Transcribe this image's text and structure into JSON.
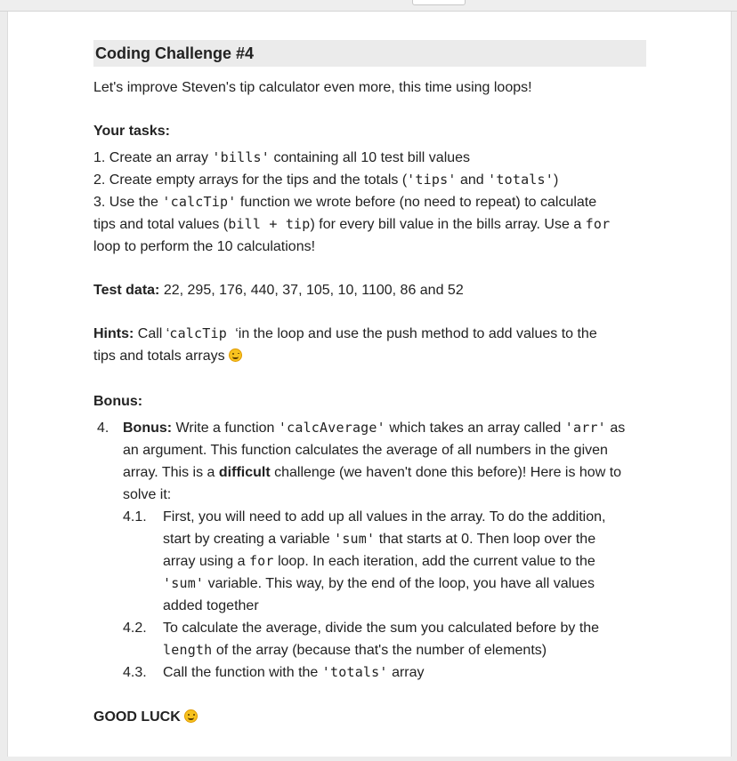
{
  "title": "Coding Challenge #4",
  "intro": "Let's improve Steven's tip calculator even more, this time using loops!",
  "tasks": {
    "heading": "Your tasks:",
    "t1_a": "1. Create an array ",
    "t1_code": "'bills'",
    "t1_b": " containing all 10 test bill values",
    "t2_a": "2. Create empty arrays for the tips and the totals (",
    "t2_code1": "'tips'",
    "t2_and": " and ",
    "t2_code2": "'totals'",
    "t2_b": ")",
    "t3_a": "3. Use the ",
    "t3_code1": "'calcTip'",
    "t3_b": " function we wrote before (no need to repeat) to calculate",
    "t3_c": "tips and total values (",
    "t3_code2": "bill + tip",
    "t3_d": ") for every bill value in the bills array. Use a ",
    "t3_code3": "for",
    "t3_e": "loop to perform the 10 calculations!"
  },
  "test_data": {
    "label": "Test data:",
    "text": " 22, 295, 176, 440, 37, 105, 10, 1100, 86 and 52"
  },
  "hints": {
    "label": "Hints:",
    "a": " Call ‘",
    "code": "calcTip ",
    "b": "‘in the loop and use the push method to add values to the",
    "c": "tips and totals arrays "
  },
  "bonus": {
    "heading": "Bonus:",
    "num": "4.",
    "label": "Bonus:",
    "a": " Write a function ",
    "code1": "'calcAverage'",
    "b": " which takes an array called ",
    "code2": "'arr'",
    "c": " as",
    "d": "an argument. This function calculates the average of all numbers in the given",
    "e": "array. This is a ",
    "difficult": "difficult",
    "f": " challenge (we haven't done this before)! Here is how to",
    "g": "solve it:",
    "s1_num": "4.1.",
    "s1_a": "First, you will need to add up all values in the array. To do the addition,",
    "s1_b": "start by creating a variable ",
    "s1_code1": "'sum'",
    "s1_c": " that starts at 0. Then loop over the",
    "s1_d": "array using a ",
    "s1_code2": "for",
    "s1_e": " loop. In each iteration, add the current value to the",
    "s1_code3": "'sum'",
    "s1_f": " variable. This way, by the end of the loop, you have all values",
    "s1_g": "added together",
    "s2_num": "4.2.",
    "s2_a": "To calculate the average, divide the sum you calculated before by the",
    "s2_code": "length",
    "s2_b": " of the array (because that's the number of elements)",
    "s3_num": "4.3.",
    "s3_a": "Call the function with the ",
    "s3_code": "'totals'",
    "s3_b": " array"
  },
  "good_luck": "GOOD LUCK ",
  "icons": {
    "wink": "winking-face-emoji",
    "grin": "grinning-face-emoji"
  }
}
